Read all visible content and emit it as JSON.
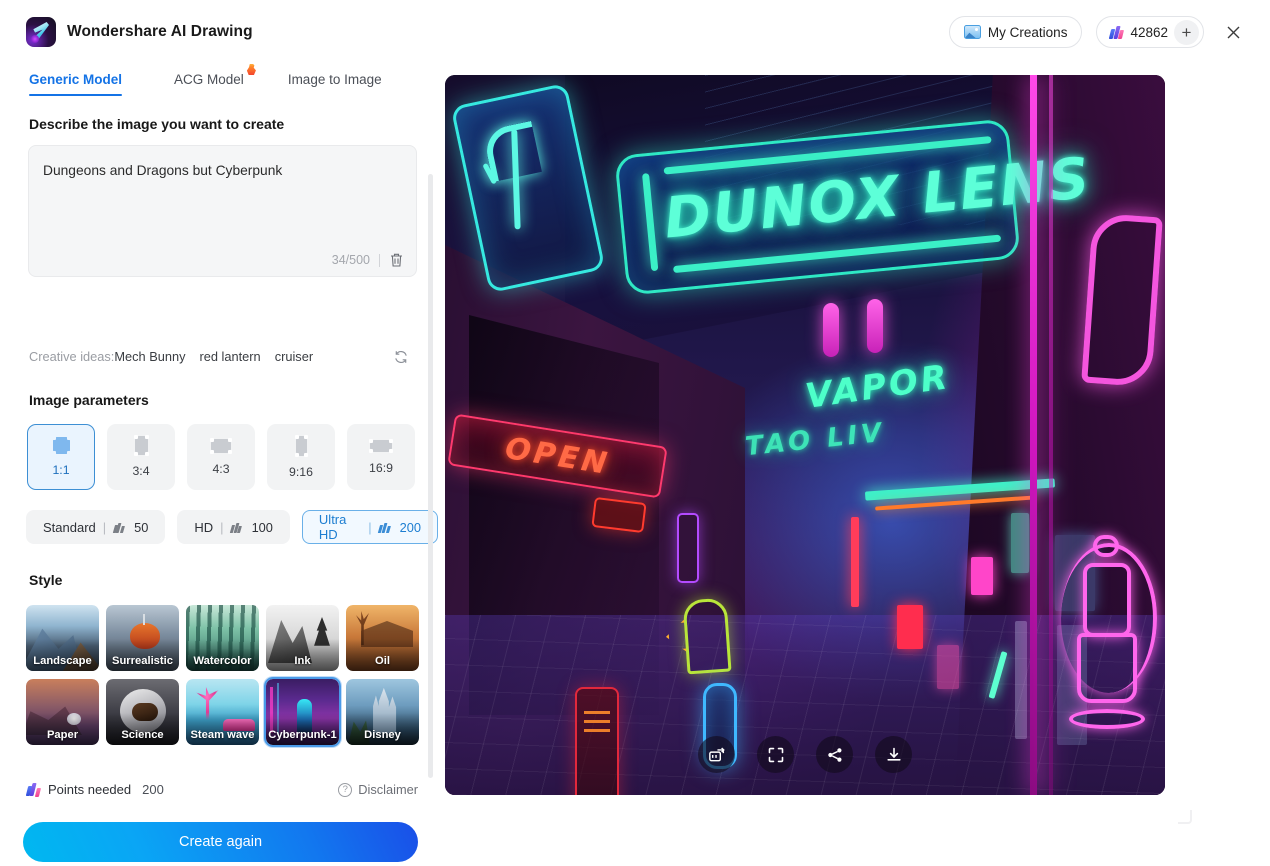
{
  "window": {
    "app_title": "Wondershare AI Drawing",
    "logo_icon": "wondershare-logo-icon",
    "close_icon": "close-icon"
  },
  "header": {
    "my_creations_label": "My Creations",
    "my_creations_icon": "image-gallery-icon",
    "credits_value": "42862",
    "credits_icon": "credits-coin-icon",
    "add_credits_label": "+"
  },
  "tabs": [
    {
      "label": "Generic Model",
      "active": true
    },
    {
      "label": "ACG Model",
      "active": false,
      "badge": "fire-icon"
    },
    {
      "label": "Image to Image",
      "active": false
    }
  ],
  "prompt": {
    "section_title": "Describe the image you want to create",
    "value": "Dungeons and Dragons but Cyberpunk",
    "placeholder": "Describe the image you want to create",
    "char_count": "34/500",
    "clear_icon": "trash-icon"
  },
  "creative_ideas": {
    "label": "Creative ideas:",
    "items": [
      "Mech Bunny",
      "red lantern",
      "cruiser"
    ],
    "refresh_icon": "refresh-icon"
  },
  "image_parameters": {
    "section_title": "Image parameters",
    "ratios": [
      {
        "label": "1:1",
        "selected": true
      },
      {
        "label": "3:4",
        "selected": false
      },
      {
        "label": "4:3",
        "selected": false
      },
      {
        "label": "9:16",
        "selected": false
      },
      {
        "label": "16:9",
        "selected": false
      }
    ],
    "qualities": [
      {
        "name": "Standard",
        "separator": "|",
        "points": "50",
        "selected": false
      },
      {
        "name": "HD",
        "separator": "|",
        "points": "100",
        "selected": false
      },
      {
        "name": "Ultra HD",
        "separator": "|",
        "points": "200",
        "selected": true
      }
    ]
  },
  "style": {
    "section_title": "Style",
    "items": [
      {
        "label": "Landscape",
        "selected": false,
        "thumb": "th-landscape"
      },
      {
        "label": "Surrealistic",
        "selected": false,
        "thumb": "th-surreal"
      },
      {
        "label": "Watercolor",
        "selected": false,
        "thumb": "th-water"
      },
      {
        "label": "Ink",
        "selected": false,
        "thumb": "th-ink"
      },
      {
        "label": "Oil",
        "selected": false,
        "thumb": "th-oil"
      },
      {
        "label": "Paper",
        "selected": false,
        "thumb": "th-paper"
      },
      {
        "label": "Science",
        "selected": false,
        "thumb": "th-science"
      },
      {
        "label": "Steam wave",
        "selected": false,
        "thumb": "th-steam"
      },
      {
        "label": "Cyberpunk-1",
        "selected": true,
        "thumb": "th-cyber"
      },
      {
        "label": "Disney",
        "selected": false,
        "thumb": "th-disney"
      }
    ]
  },
  "footer": {
    "points_label": "Points needed",
    "points_value": "200",
    "points_icon": "credits-coin-icon",
    "disclaimer_label": "Disclaimer",
    "disclaimer_icon": "question-mark-icon",
    "create_button_label": "Create again"
  },
  "generated_image": {
    "neon_sign_main": "DUNOX LENS",
    "neon_sign_open": "OPEN",
    "neon_sign_vapor": "VAPOR",
    "neon_sign_vapor_secondary": "TAO LIV",
    "toolbar": [
      {
        "name": "hd-upscale-button",
        "icon": "hd-upscale-icon"
      },
      {
        "name": "fullscreen-button",
        "icon": "expand-icon"
      },
      {
        "name": "share-button",
        "icon": "share-icon"
      },
      {
        "name": "download-button",
        "icon": "download-icon"
      }
    ]
  },
  "colors": {
    "accent_blue": "#1473e6",
    "panel_bg": "#f5f6f7",
    "selected_border": "#3d8fd4",
    "button_gradient_from": "#00b8f0",
    "button_gradient_to": "#1a4fe8"
  }
}
